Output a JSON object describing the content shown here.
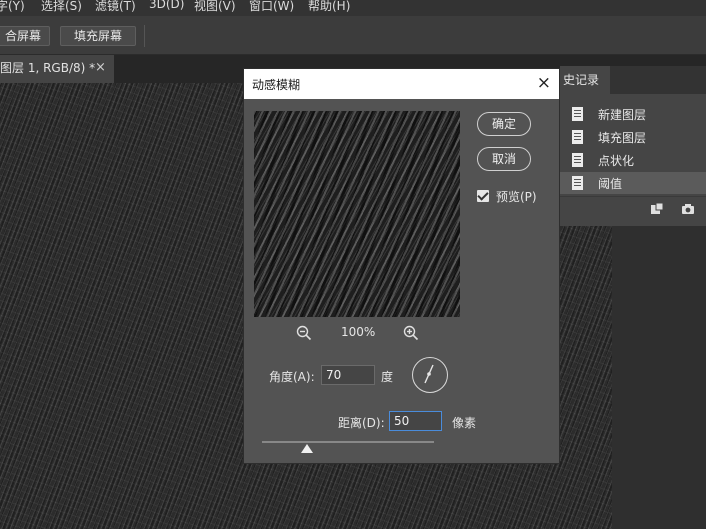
{
  "menu": {
    "items": [
      "字(Y)",
      "选择(S)",
      "滤镜(T)",
      "3D(D)",
      "视图(V)",
      "窗口(W)",
      "帮助(H)"
    ]
  },
  "options_bar": {
    "fit_screen": "合屏幕",
    "fill_screen": "填充屏幕"
  },
  "doc_tab": {
    "title": "图层 1, RGB/8) *",
    "close": "×"
  },
  "history_panel": {
    "tab": "史记录",
    "items": [
      {
        "label": "新建图层",
        "selected": false
      },
      {
        "label": "填充图层",
        "selected": false
      },
      {
        "label": "点状化",
        "selected": false
      },
      {
        "label": "阈值",
        "selected": true
      }
    ]
  },
  "dialog": {
    "title": "动感模糊",
    "close": "×",
    "ok": "确定",
    "cancel": "取消",
    "preview_label": "预览(P)",
    "preview_checked": true,
    "zoom": "100%",
    "angle_label": "角度(A):",
    "angle_value": "70",
    "angle_unit": "度",
    "distance_label": "距离(D):",
    "distance_value": "50",
    "distance_unit": "像素",
    "icons": [
      "zoom-out-icon",
      "zoom-in-icon",
      "angle-dial-icon"
    ]
  },
  "colors": {
    "dialog_bg": "#535353",
    "focus_border": "#4a8cdb",
    "selected_history": "#5b5b5b"
  }
}
